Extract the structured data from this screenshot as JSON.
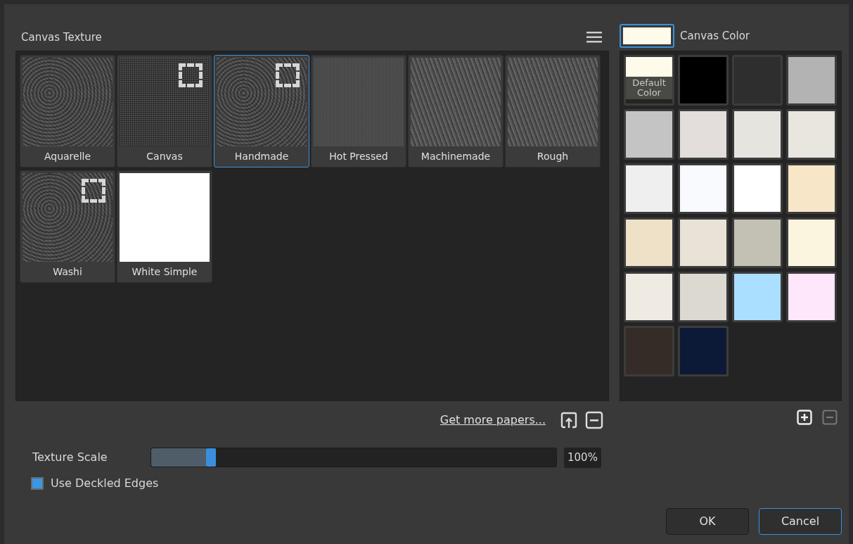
{
  "texture_panel": {
    "title": "Canvas Texture"
  },
  "textures": [
    {
      "label": "Aquarelle",
      "selected": false,
      "stamp": false
    },
    {
      "label": "Canvas",
      "selected": false,
      "stamp": true
    },
    {
      "label": "Handmade",
      "selected": true,
      "stamp": true
    },
    {
      "label": "Hot Pressed",
      "selected": false,
      "stamp": false
    },
    {
      "label": "Machinemade",
      "selected": false,
      "stamp": false
    },
    {
      "label": "Rough",
      "selected": false,
      "stamp": false
    },
    {
      "label": "Washi",
      "selected": false,
      "stamp": true
    },
    {
      "label": "White Simple",
      "selected": false,
      "stamp": false
    }
  ],
  "get_more_link": "Get more papers...",
  "texture_scale": {
    "label": "Texture Scale",
    "level": 0.16,
    "reading": "100%"
  },
  "deckled_edges": {
    "label": "Use Deckled Edges",
    "checked": true
  },
  "canvas_color": {
    "label": "Canvas Color",
    "color": "#fffbea"
  },
  "swatches": [
    {
      "color": "#fffbea",
      "label": "Default Color"
    },
    {
      "color": "#000000"
    },
    {
      "color": "#2e2e2e"
    },
    {
      "color": "#b3b3b3"
    },
    {
      "color": "#c4c4c4"
    },
    {
      "color": "#e3dedb"
    },
    {
      "color": "#e6e4df"
    },
    {
      "color": "#e9e6e0"
    },
    {
      "color": "#efefef"
    },
    {
      "color": "#f8fafe"
    },
    {
      "color": "#ffffff"
    },
    {
      "color": "#f8e6c8"
    },
    {
      "color": "#efe1c8"
    },
    {
      "color": "#e8e3d6"
    },
    {
      "color": "#c3c1b3"
    },
    {
      "color": "#fbf4de"
    },
    {
      "color": "#efebe3"
    },
    {
      "color": "#dcdad0"
    },
    {
      "color": "#abdfff"
    },
    {
      "color": "#fee6fb"
    },
    {
      "color": "#352c28"
    },
    {
      "color": "#0c1a38"
    }
  ],
  "color_remove_disabled": true,
  "buttons": [
    {
      "label": "OK",
      "default": false
    },
    {
      "label": "Cancel",
      "default": true
    }
  ]
}
